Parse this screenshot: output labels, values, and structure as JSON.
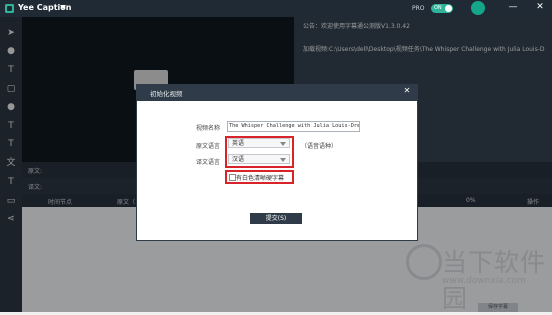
{
  "titlebar": {
    "app_title": "Yee Caption",
    "pro_label": "PRO",
    "toggle_label": "ON",
    "min_glyph": "—",
    "close_glyph": "✕"
  },
  "info": {
    "notice": "公告：欢迎使用字幕通公测版V1.3.0.42",
    "load_path": "加载视频:C:\\Users\\dell\\Desktop\\视频任务\\The Whisper Challenge with Julia Louis-D"
  },
  "rows": {
    "original_label": "原文:",
    "translation_label": "译文:"
  },
  "columns": {
    "start_time": "时间节点",
    "original": "原文（",
    "percent": "0%",
    "operation": "操作"
  },
  "dialog": {
    "title": "初始化视频",
    "close_glyph": "✕",
    "video_name_label": "视频名称",
    "video_name_value": "The Whisper Challenge with Julia Louis-Dreyfus",
    "source_lang_label": "原文语言",
    "source_lang_value": "英语",
    "source_lang_note": "（语音语种）",
    "target_lang_label": "译文语言",
    "target_lang_value": "汉语",
    "hardsub_label": "有白色清晰硬字幕",
    "hardsub_checked": false,
    "submit_label": "提交(S)"
  },
  "watermark": {
    "text": "当下软件园",
    "url": "www.downxia.com"
  },
  "save_button": "保存字幕",
  "colors": {
    "titlebar": "#1f2a35",
    "toolbar": "#2a3541",
    "accent_toggle": "#2fb49a",
    "highlight": "#d8232a",
    "dialog_header": "#2f3b48"
  },
  "icons": [
    "cursor-icon",
    "mic-icon",
    "text-icon",
    "microphone-icon",
    "text-box-icon",
    "text-icon",
    "text-icon",
    "monitor-icon",
    "share-icon"
  ]
}
